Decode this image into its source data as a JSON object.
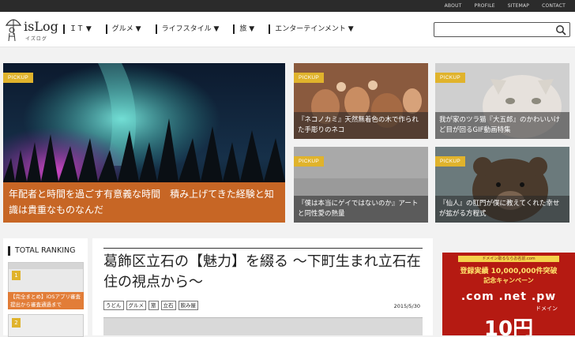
{
  "topbar": {
    "links": [
      "ABOUT",
      "PROFILE",
      "SITEMAP",
      "CONTACT"
    ]
  },
  "header": {
    "logo_text": "isLog",
    "logo_sub": "イズログ",
    "nav": [
      "ＩＴ ▼",
      "グルメ ▼",
      "ライフスタイル ▼",
      "旅 ▼",
      "エンターテインメント ▼"
    ],
    "search_placeholder": ""
  },
  "features": [
    {
      "badge": "PICKUP",
      "caption": "年配者と時間を過ごす有意義な時間　積み上げてきた経験と知識は貴重なものなんだ"
    },
    {
      "badge": "PICKUP",
      "caption": "『ネコノカミ』天然無着色の木で作られた手彫りのネコ"
    },
    {
      "badge": "PICKUP",
      "caption": "我が家のツラ猫『大五郎』のかわいいけど目が回るGIF動画特集"
    },
    {
      "badge": "PICKUP",
      "caption": "『僕は本当にゲイではないのか』アートと同性愛の熱量"
    },
    {
      "badge": "PICKUP",
      "caption": "『仙人』の肛門が僕に教えてくれた幸せが拡がる方程式"
    }
  ],
  "ranking": {
    "title": "TOTAL RANKING",
    "item1_num": "1",
    "item1_caption": "【完全まとめ】iOSアプリ審査提出から審査通過まで",
    "item2_num": "2"
  },
  "article": {
    "title": "葛飾区立石の【魅力】を綴る 〜下町生まれ立石在住の視点から〜",
    "tags": [
      "うどん",
      "グルメ",
      "旅",
      "立石",
      "飲み屋"
    ],
    "date": "2015/5/30"
  },
  "ad": {
    "top": "ドメイン取るならお名前.com",
    "line1": "登録実績 10,000,000件突破",
    "line2": "記念キャンペーン",
    "line3": ".com .net .pw",
    "line4": "ドメイン",
    "line5": "10円"
  },
  "colors": {
    "pickup": "#e0b32c",
    "orange_caption": "#e17328",
    "topbar": "#2b2b2b"
  }
}
